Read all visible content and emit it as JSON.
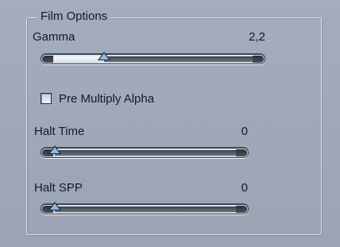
{
  "group": {
    "title": "Film Options"
  },
  "gamma": {
    "label": "Gamma",
    "value": "2,2",
    "fraction": 0.25
  },
  "pre_multiply_alpha": {
    "label": "Pre Multiply Alpha",
    "checked": false
  },
  "halt_time": {
    "label": "Halt Time",
    "value": "0",
    "fraction": 0
  },
  "halt_spp": {
    "label": "Halt SPP",
    "value": "0",
    "fraction": 0
  }
}
